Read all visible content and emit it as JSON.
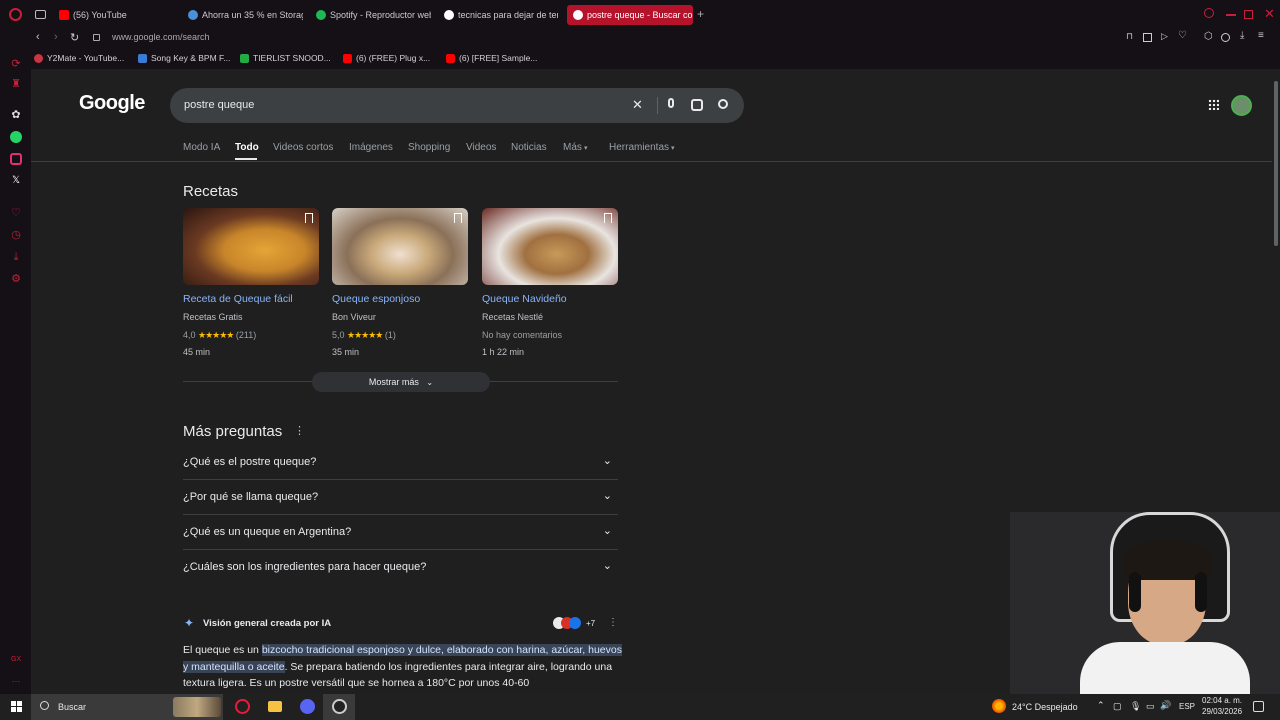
{
  "browser": {
    "tabs": [
      {
        "label": "(56) YouTube",
        "color": "#ff0000"
      },
      {
        "label": "Ahorra un 35 % en Storag",
        "color": "#4a90d9"
      },
      {
        "label": "Spotify - Reproductor web",
        "color": "#1db954"
      },
      {
        "label": "tecnicas para dejar de ten",
        "color": "#ffffff"
      },
      {
        "label": "postre queque - Buscar co",
        "color": "#ffffff",
        "active": true
      }
    ],
    "url": "www.google.com/search",
    "bookmarks": [
      {
        "label": "Y2Mate - YouTube...",
        "color": "#cc3344"
      },
      {
        "label": "Song Key & BPM F...",
        "color": "#3a7bd5"
      },
      {
        "label": "TIERLIST SNOOD...",
        "color": "#22aa44"
      },
      {
        "label": "(6) (FREE) Plug x...",
        "color": "#ff0000"
      },
      {
        "label": "(6) [FREE] Sample...",
        "color": "#ff0000"
      }
    ]
  },
  "google": {
    "logo": "Google",
    "query": "postre queque",
    "tabs": [
      "Modo IA",
      "Todo",
      "Videos cortos",
      "Imágenes",
      "Shopping",
      "Videos",
      "Noticias",
      "Más",
      "Herramientas"
    ],
    "recipes_heading": "Recetas",
    "recipes": [
      {
        "title": "Receta de Queque fácil",
        "source": "Recetas Gratis",
        "rating": "4,0",
        "stars": "★★★★★",
        "count": "(211)",
        "time": "45 min"
      },
      {
        "title": "Queque esponjoso",
        "source": "Bon Viveur",
        "rating": "5,0",
        "stars": "★★★★★",
        "count": "(1)",
        "time": "35 min"
      },
      {
        "title": "Queque Navideño",
        "source": "Recetas Nestlé",
        "rating": "No hay comentarios",
        "stars": "",
        "count": "",
        "time": "1 h 22 min"
      }
    ],
    "show_more": "Mostrar más",
    "faq_heading": "Más preguntas",
    "faqs": [
      "¿Qué es el postre queque?",
      "¿Por qué se llama queque?",
      "¿Qué es un queque en Argentina?",
      "¿Cuáles son los ingredientes para hacer queque?"
    ],
    "ai": {
      "title": "Visión general creada por IA",
      "sources_more": "+7",
      "p_start": "El queque es un ",
      "p_highlight": "bizcocho tradicional esponjoso y dulce, elaborado con harina, azúcar, huevos y mantequilla o aceite",
      "p_end": ". Se prepara batiendo los ingredientes para integrar aire, logrando una textura ligera. Es un postre versátil que se hornea a 180°C por unos 40-60"
    }
  },
  "taskbar": {
    "search_placeholder": "Buscar",
    "weather": "24°C  Despejado",
    "lang": "ESP",
    "time": "02:04 a. m.",
    "date": "29/03/2026"
  }
}
